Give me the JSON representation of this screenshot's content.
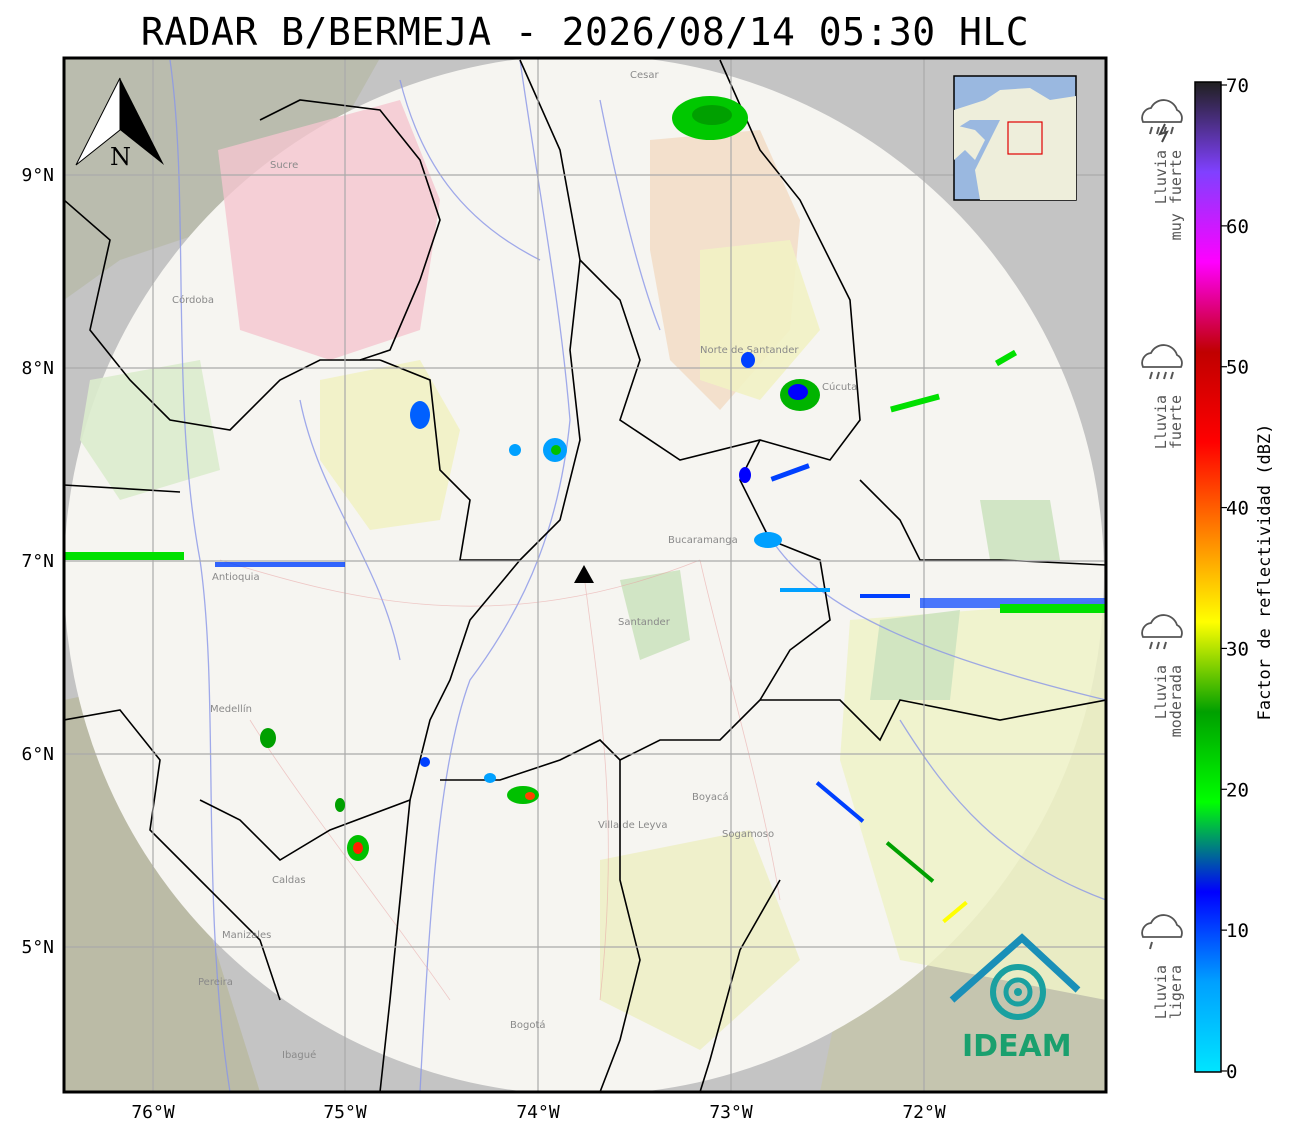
{
  "title": "RADAR B/BERMEJA - 2026/08/14 05:30 HLC",
  "north_label": "N",
  "logo_text": "IDEAM",
  "lon_labels": [
    "76°W",
    "75°W",
    "74°W",
    "73°W",
    "72°W"
  ],
  "lat_labels": [
    "9°N",
    "8°N",
    "7°N",
    "6°N",
    "5°N"
  ],
  "colorbar": {
    "title": "Factor de reflectividad (dBZ)",
    "ticks": [
      "70",
      "60",
      "50",
      "40",
      "30",
      "20",
      "10",
      "0"
    ],
    "stops": [
      "#00e5ff",
      "#00a0ff",
      "#0000ff",
      "#00ff00",
      "#00a000",
      "#ffff00",
      "#ff8000",
      "#ff0000",
      "#c00000",
      "#ff00ff",
      "#8040ff",
      "#202020"
    ]
  },
  "rain_categories": [
    {
      "label": "Lluvia muy fuerte",
      "icon": "storm-cloud-icon"
    },
    {
      "label": "Lluvia fuerte",
      "icon": "heavy-rain-cloud-icon"
    },
    {
      "label": "Lluvia moderada",
      "icon": "moderate-rain-cloud-icon"
    },
    {
      "label": "Lluvia ligera",
      "icon": "light-rain-cloud-icon"
    }
  ],
  "places": [
    "Cesar",
    "Sucre",
    "Córdoba",
    "Norte de Santander",
    "Antioquia",
    "Medellín",
    "Santander",
    "Bucaramanga",
    "Boyacá",
    "Caldas",
    "Manizales",
    "Pereira",
    "Ibagué",
    "Bogotá",
    "Cúcuta",
    "Sogamoso",
    "Villa de Leyva"
  ],
  "colors": {
    "radar_site": "#000000",
    "frame": "#000000",
    "grid": "#aaaaaa"
  }
}
